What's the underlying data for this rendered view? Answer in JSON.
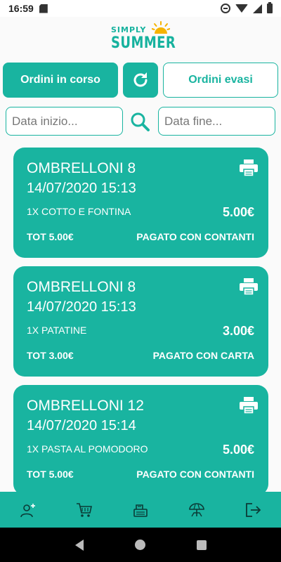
{
  "status_bar": {
    "time": "16:59",
    "icons": [
      "sd-card-icon",
      "do-not-disturb-icon",
      "wifi-icon",
      "signal-icon",
      "battery-icon"
    ]
  },
  "logo": {
    "line1": "SIMPLY",
    "line2": "SUMMER",
    "sun_color": "#f5b301"
  },
  "controls": {
    "active_tab": "Ordini in corso",
    "refresh_icon": "refresh-icon",
    "other_tab": "Ordini evasi",
    "date_start_placeholder": "Data inizio...",
    "date_end_placeholder": "Data fine...",
    "search_icon": "search-icon"
  },
  "orders": [
    {
      "place": "OMBRELLONI 8",
      "datetime": "14/07/2020 15:13",
      "item": "1X  COTTO E FONTINA",
      "price": "5.00€",
      "total": "TOT 5.00€",
      "payment": "PAGATO CON CONTANTI"
    },
    {
      "place": "OMBRELLONI 8",
      "datetime": "14/07/2020 15:13",
      "item": "1X  PATATINE",
      "price": "3.00€",
      "total": "TOT 3.00€",
      "payment": "PAGATO CON CARTA"
    },
    {
      "place": "OMBRELLONI 12",
      "datetime": "14/07/2020 15:14",
      "item": "1X  PASTA AL POMODORO",
      "price": "5.00€",
      "total": "TOT 5.00€",
      "payment": "PAGATO CON CONTANTI"
    }
  ],
  "bottom_nav": [
    "add-user-icon",
    "cart-icon",
    "register-icon",
    "beach-umbrella-icon",
    "logout-icon"
  ],
  "colors": {
    "accent": "#19b4a0",
    "background": "#fafafa",
    "text_on_accent": "#ffffff"
  }
}
